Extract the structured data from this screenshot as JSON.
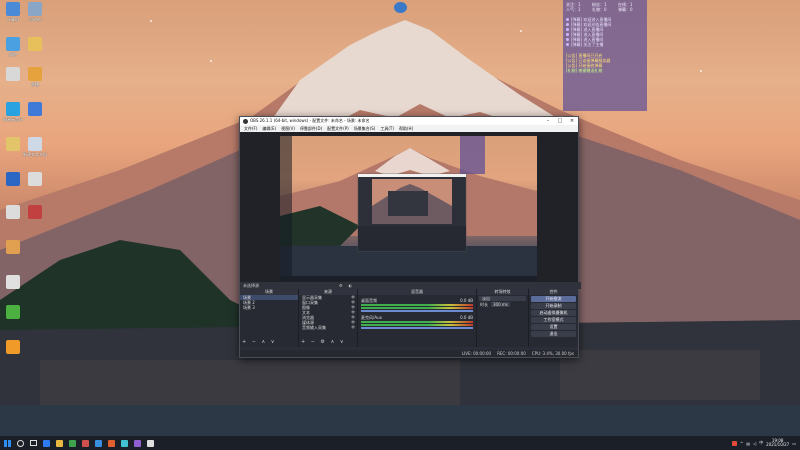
{
  "desktop": {
    "icons": [
      {
        "label": "计算机",
        "color": "#4b8ad6"
      },
      {
        "label": "回收站",
        "color": "#8aa6c6"
      },
      {
        "label": "网络",
        "color": "#4aa0e0"
      },
      {
        "label": "",
        "color": "#e7c05b"
      },
      {
        "label": "",
        "color": "#d8d8d8"
      },
      {
        "label": "直播",
        "color": "#e6a23c"
      },
      {
        "label": "网易云音乐",
        "color": "#2aa1e0"
      },
      {
        "label": "",
        "color": "#3f7ad8"
      },
      {
        "label": "",
        "color": "#e2c56a"
      },
      {
        "label": "新建文本文档",
        "color": "#cfd8e6"
      },
      {
        "label": "",
        "color": "#2a66c4"
      },
      {
        "label": "",
        "color": "#dcdcdc"
      },
      {
        "label": "",
        "color": "#dcdcdc"
      },
      {
        "label": "",
        "color": "#c24040"
      },
      {
        "label": "",
        "color": "#e0a050"
      },
      {
        "label": "",
        "color": "#e0e0e0"
      },
      {
        "label": "",
        "color": "#4cb040"
      },
      {
        "label": "",
        "color": "#f09a2a"
      }
    ]
  },
  "chat": {
    "stats": [
      "关注：1",
      "粉丝：1",
      "在线：1",
      "人气：1",
      "礼物：0",
      "弹幕：0"
    ],
    "messages": [
      "[弹幕] 欢迎进入直播间",
      "[弹幕] 欢迎光临直播间",
      "[弹幕] 进入直播间",
      "[弹幕] 进入直播间",
      "[弹幕] 进入直播间",
      "[弹幕] 关注了主播"
    ],
    "system": [
      "[公告] 直播间已开启",
      "[公告] 已连接弹幕服务器",
      "[公告] 开始接收弹幕"
    ],
    "gift": "[礼物] 感谢赠送礼物"
  },
  "obs": {
    "title": "OBS 26.1.1 (64-bit, windows) - 配置文件: 未命名 - 场景: 未命名",
    "menu": [
      "文件(F)",
      "编辑(E)",
      "视图(V)",
      "停靠部件(D)",
      "配置文件(P)",
      "场景集合(S)",
      "工具(T)",
      "帮助(H)"
    ],
    "scene_label": "未选择源",
    "docks": {
      "scenes": {
        "header": "场景",
        "items": [
          "场景",
          "场景 2",
          "场景 3"
        ]
      },
      "sources": {
        "header": "来源",
        "items": [
          "显示器采集",
          "窗口采集",
          "图像",
          "文本",
          "浏览器",
          "媒体源",
          "音频输入采集"
        ]
      },
      "mixer": {
        "header": "混音器",
        "channels": [
          "桌面音频",
          "麦克风/Aux"
        ],
        "db": "0.0 dB"
      },
      "transitions": {
        "header": "转场特效",
        "type": "淡出",
        "duration_label": "时长",
        "duration": "300 ms"
      },
      "controls": {
        "header": "控件",
        "buttons": [
          "开始推流",
          "开始录制",
          "启动虚拟摄像机",
          "工作室模式",
          "设置",
          "退出"
        ]
      }
    },
    "status": [
      "LIVE: 00:00:00",
      "REC: 00:00:00",
      "CPU: 3.4%, 30.00 fps"
    ]
  },
  "taskbar": {
    "apps": [
      "#2f7cf0",
      "#e8b840",
      "#3fa34d",
      "#d05050",
      "#3a90e0",
      "#e06030",
      "#40c0d0",
      "#9060d0",
      "#e0e0e0"
    ],
    "time": "19:08",
    "date": "2021/10/27",
    "ime": "中"
  }
}
